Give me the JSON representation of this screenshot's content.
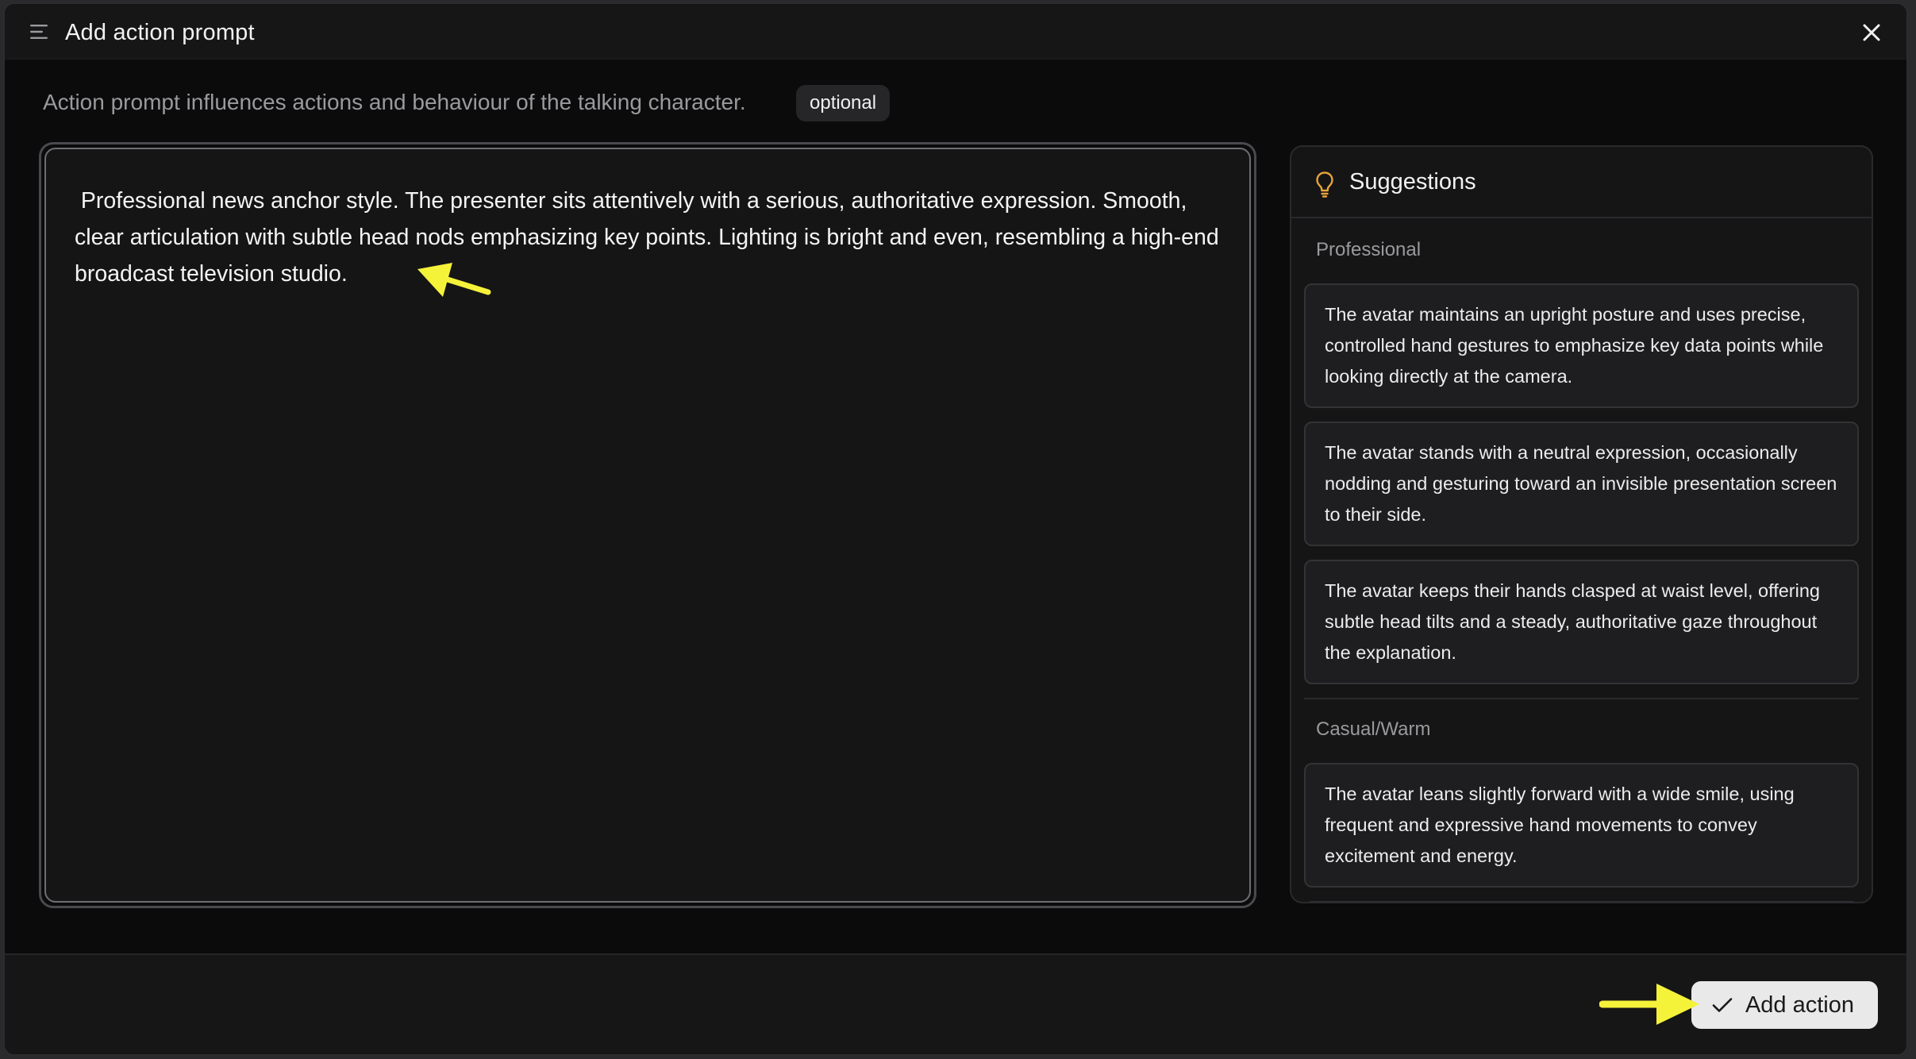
{
  "modal": {
    "title": "Add action prompt",
    "description": "Action prompt influences actions and behaviour of the talking character.",
    "badge": "optional",
    "menu_icon": "menu-lines-icon",
    "close_icon": "close-icon"
  },
  "prompt": {
    "value": " Professional news anchor style. The presenter sits attentively with a serious, authoritative expression. Smooth, clear articulation with subtle head nods emphasizing key points. Lighting is bright and even, resembling a high-end broadcast television studio."
  },
  "suggestions": {
    "title": "Suggestions",
    "icon": "lightbulb-icon",
    "icon_color": "#e8a33a",
    "categories": [
      {
        "label": "Professional",
        "items": [
          "The avatar maintains an upright posture and uses precise, controlled hand gestures to emphasize key data points while looking directly at the camera.",
          "The avatar stands with a neutral expression, occasionally nodding and gesturing toward an invisible presentation screen to their side.",
          "The avatar keeps their hands clasped at waist level, offering subtle head tilts and a steady, authoritative gaze throughout the explanation."
        ]
      },
      {
        "label": "Casual/Warm",
        "items": [
          "The avatar leans slightly forward with a wide smile, using frequent and expressive hand movements to convey excitement and energy."
        ]
      }
    ]
  },
  "footer": {
    "add_label": "Add action",
    "add_icon": "check-icon"
  },
  "annotations": {
    "arrow_color": "#f5f23a"
  }
}
